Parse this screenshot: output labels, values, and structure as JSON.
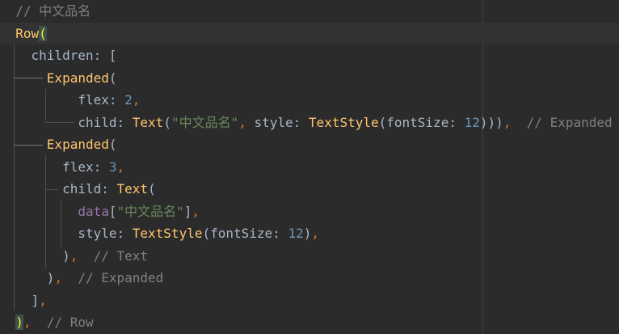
{
  "colors": {
    "background": "#2b2b2b",
    "current_line": "#323232",
    "plain": "#a9b7c6",
    "comment": "#808080",
    "class_name": "#ffc66d",
    "punctuation": "#cc7832",
    "number": "#6897bb",
    "string": "#6a8759",
    "field": "#9876aa",
    "brace_highlight": "#ffef28"
  },
  "code": {
    "lines": [
      {
        "current": false,
        "tokens": [
          {
            "t": "  // 中文品名",
            "c": "comment"
          }
        ]
      },
      {
        "current": true,
        "tokens": [
          {
            "t": "  Row",
            "c": "class"
          },
          {
            "t": "(",
            "c": "brace-hl"
          }
        ]
      },
      {
        "current": false,
        "tokens": [
          {
            "t": "    children: [",
            "c": "plain"
          }
        ]
      },
      {
        "current": false,
        "tokens": [
          {
            "t": "      Expanded",
            "c": "class"
          },
          {
            "t": "(",
            "c": "plain"
          }
        ]
      },
      {
        "current": false,
        "tokens": [
          {
            "t": "          flex: ",
            "c": "plain"
          },
          {
            "t": "2",
            "c": "number"
          },
          {
            "t": ",",
            "c": "comma"
          }
        ]
      },
      {
        "current": false,
        "tokens": [
          {
            "t": "          child: ",
            "c": "plain"
          },
          {
            "t": "Text",
            "c": "class"
          },
          {
            "t": "(",
            "c": "plain"
          },
          {
            "t": "\"中文品名\"",
            "c": "string"
          },
          {
            "t": ", ",
            "c": "comma"
          },
          {
            "t": "style: ",
            "c": "plain"
          },
          {
            "t": "TextStyle",
            "c": "class"
          },
          {
            "t": "(fontSize: ",
            "c": "plain"
          },
          {
            "t": "12",
            "c": "number"
          },
          {
            "t": "))",
            "c": "plain"
          },
          {
            "t": ")",
            "c": "plain"
          },
          {
            "t": ",",
            "c": "comma"
          },
          {
            "t": "  // Expanded",
            "c": "comment"
          }
        ]
      },
      {
        "current": false,
        "tokens": [
          {
            "t": "      Expanded",
            "c": "class"
          },
          {
            "t": "(",
            "c": "plain"
          }
        ]
      },
      {
        "current": false,
        "tokens": [
          {
            "t": "        flex: ",
            "c": "plain"
          },
          {
            "t": "3",
            "c": "number"
          },
          {
            "t": ",",
            "c": "comma"
          }
        ]
      },
      {
        "current": false,
        "tokens": [
          {
            "t": "        child: ",
            "c": "plain"
          },
          {
            "t": "Text",
            "c": "class"
          },
          {
            "t": "(",
            "c": "plain"
          }
        ]
      },
      {
        "current": false,
        "tokens": [
          {
            "t": "          ",
            "c": "plain"
          },
          {
            "t": "data",
            "c": "purple"
          },
          {
            "t": "[",
            "c": "plain"
          },
          {
            "t": "\"中文品名\"",
            "c": "string"
          },
          {
            "t": "]",
            "c": "plain"
          },
          {
            "t": ",",
            "c": "comma"
          }
        ]
      },
      {
        "current": false,
        "tokens": [
          {
            "t": "          style: ",
            "c": "plain"
          },
          {
            "t": "TextStyle",
            "c": "class"
          },
          {
            "t": "(fontSize: ",
            "c": "plain"
          },
          {
            "t": "12",
            "c": "number"
          },
          {
            "t": ")",
            "c": "plain"
          },
          {
            "t": ",",
            "c": "comma"
          }
        ]
      },
      {
        "current": false,
        "tokens": [
          {
            "t": "        )",
            "c": "plain"
          },
          {
            "t": ",",
            "c": "comma"
          },
          {
            "t": "  // Text",
            "c": "comment"
          }
        ]
      },
      {
        "current": false,
        "tokens": [
          {
            "t": "      )",
            "c": "plain"
          },
          {
            "t": ",",
            "c": "comma"
          },
          {
            "t": "  // Expanded",
            "c": "comment"
          }
        ]
      },
      {
        "current": false,
        "tokens": [
          {
            "t": "    ]",
            "c": "plain"
          },
          {
            "t": ",",
            "c": "comma"
          }
        ]
      },
      {
        "current": false,
        "tokens": [
          {
            "t": "  ",
            "c": "plain"
          },
          {
            "t": ")",
            "c": "brace-hl"
          },
          {
            "t": ",",
            "c": "comma"
          },
          {
            "t": "  // Row",
            "c": "comment"
          }
        ]
      }
    ]
  }
}
